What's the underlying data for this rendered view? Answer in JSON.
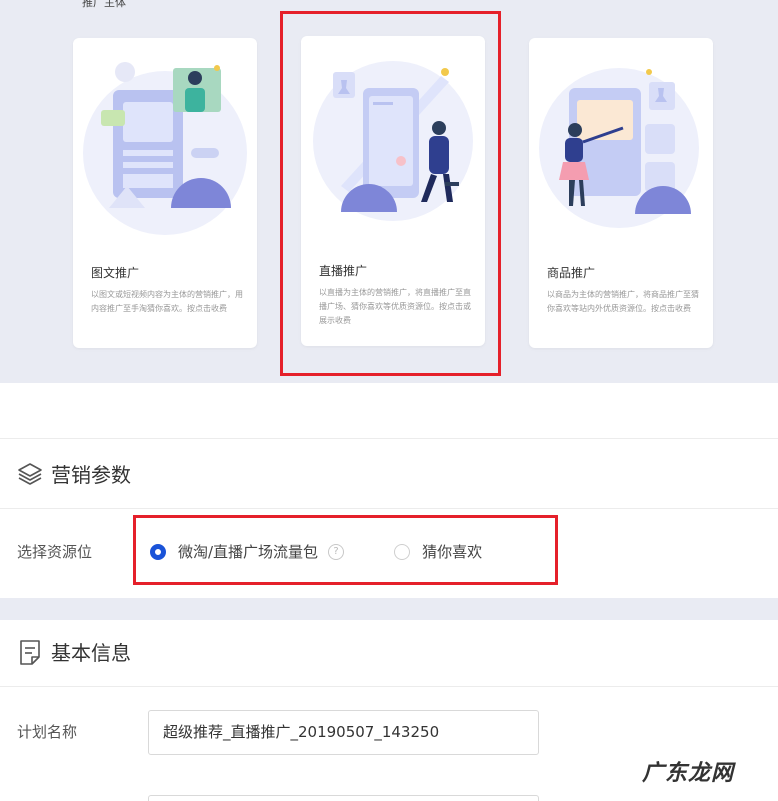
{
  "promo": {
    "section_label": "推广主体",
    "cards": [
      {
        "title": "图文推广",
        "desc": "以图文或短视频内容为主体的营销推广，用内容推广至手淘猜你喜欢。按点击收费"
      },
      {
        "title": "直播推广",
        "desc": "以直播为主体的营销推广，将直播推广至直播广场、猜你喜欢等优质资源位。按点击或展示收费"
      },
      {
        "title": "商品推广",
        "desc": "以商品为主体的营销推广，将商品推广至猜你喜欢等站内外优质资源位。按点击收费"
      }
    ]
  },
  "marketing": {
    "title": "营销参数",
    "field_label": "选择资源位",
    "options": [
      {
        "label": "微淘/直播广场流量包",
        "selected": true
      },
      {
        "label": "猜你喜欢",
        "selected": false
      }
    ],
    "help_symbol": "?"
  },
  "basic": {
    "title": "基本信息",
    "plan_label": "计划名称",
    "plan_value": "超级推荐_直播推广_20190507_143250"
  },
  "watermark": "广东龙网",
  "colors": {
    "accent": "#1a53d8",
    "highlight": "#e5202a",
    "background": "#e9ebf3"
  }
}
